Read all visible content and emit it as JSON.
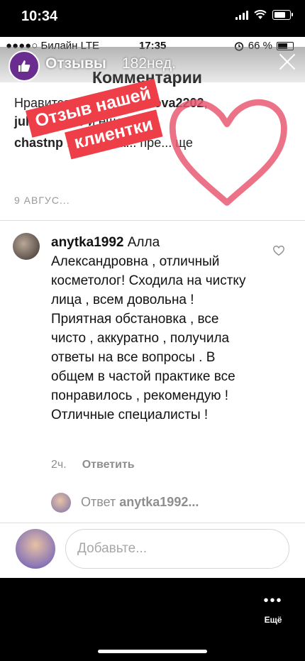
{
  "os_status": {
    "time": "10:34"
  },
  "inner_status": {
    "carrier": "●●●●○ Билайн  LTE",
    "time": "17:35",
    "battery": "66 %"
  },
  "story": {
    "name": "Отзывы",
    "time_ago": "182нед."
  },
  "screen_title": "Комментарии",
  "likes_line": {
    "prefix": "Нравится ",
    "user1": "yana_kuznecova2202",
    "sep": ", ",
    "user2": "julia_gaiver",
    "suffix": " и еще"
  },
  "caption": {
    "user": "chastnp",
    "text": "...ись на а... пре... ще"
  },
  "caption_date": "9 АВГУС...",
  "sticker": {
    "line1": "Отзыв нашей",
    "line2": "клиентки"
  },
  "comment": {
    "user": "anytka1992",
    "text": " Алла Александровна , отличный косметолог! Сходила на чистку лица , всем довольна ! Приятная обстановка , все чисто , аккуратно , получила ответы на все вопросы . В общем в частой практике все понравилось , рекомендую ! Отличные специалисты !",
    "time": "2ч.",
    "reply_label": "Ответить"
  },
  "reply_prompt": {
    "prefix": "Ответ ",
    "user": "anytka1992..."
  },
  "add_comment": {
    "placeholder": "Добавьте..."
  },
  "more_label": "Ещё",
  "colors": {
    "sticker_red": "#ee3f48",
    "heart": "#e95a72",
    "story_purple": "#6a2c8f"
  }
}
